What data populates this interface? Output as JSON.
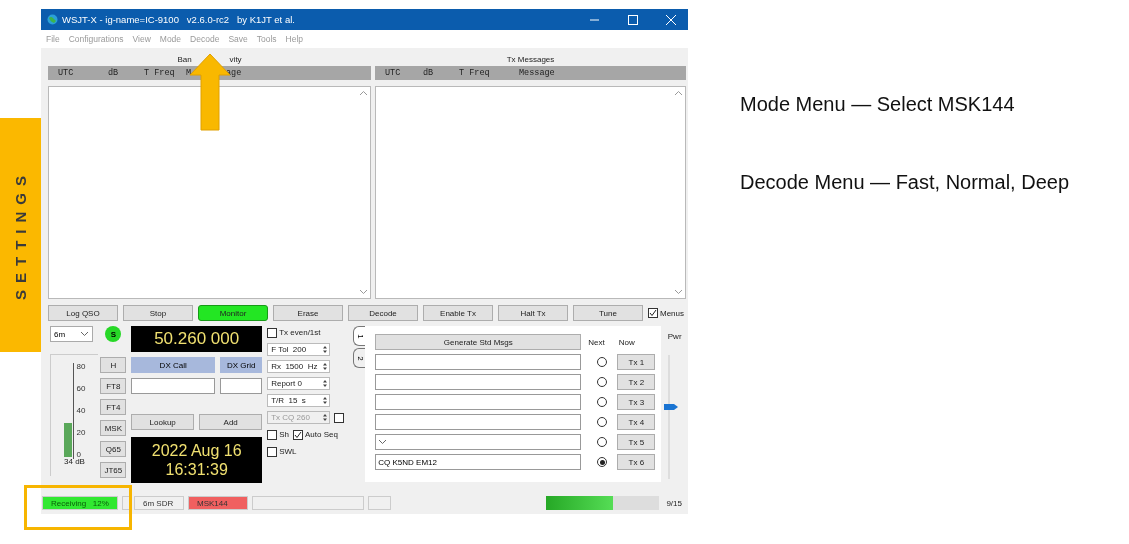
{
  "side_tab": {
    "label": "SETTINGS"
  },
  "window": {
    "title": "WSJT-X - ig-name=IC-9100   v2.6.0-rc2   by K1JT et al."
  },
  "menu": [
    "File",
    "Configurations",
    "View",
    "Mode",
    "Decode",
    "Save",
    "Tools",
    "Help"
  ],
  "band_activity": {
    "title_parts": [
      "Ban",
      "vity"
    ],
    "columns": [
      "UTC",
      "dB",
      "T Freq",
      "M",
      "age"
    ]
  },
  "tx_messages": {
    "title": "Tx Messages",
    "columns": [
      "UTC",
      "dB",
      "T Freq",
      "Message"
    ]
  },
  "buttons": [
    {
      "label": "Log QSO",
      "on": false
    },
    {
      "label": "Stop",
      "on": false
    },
    {
      "label": "Monitor",
      "on": true
    },
    {
      "label": "Erase",
      "on": false
    },
    {
      "label": "Decode",
      "on": false
    },
    {
      "label": "Enable Tx",
      "on": false
    },
    {
      "label": "Halt Tx",
      "on": false
    },
    {
      "label": "Tune",
      "on": false
    }
  ],
  "menus_checkbox": {
    "label": "Menus",
    "checked": true
  },
  "band": {
    "value": "6m"
  },
  "s_indicator": "S",
  "signal_meter": {
    "ticks": [
      "80",
      "60",
      "40",
      "20",
      "0"
    ],
    "level": 0.38,
    "reading": "34 dB"
  },
  "mode_buttons": [
    "H",
    "FT8",
    "FT4",
    "MSK",
    "Q65",
    "JT65"
  ],
  "frequency": "50.260 000",
  "dx_labels": [
    "DX Call",
    "DX Grid"
  ],
  "lookup_buttons": [
    "Lookup",
    "Add"
  ],
  "clock": {
    "date": "2022 Aug 16",
    "time": "16:31:39"
  },
  "options": [
    {
      "items": [
        {
          "kind": "checkbox",
          "label": "Tx even/1st",
          "checked": false
        }
      ]
    },
    {
      "items": [
        {
          "kind": "spin",
          "value": "F Tol  200",
          "disabled": false
        }
      ]
    },
    {
      "items": [
        {
          "kind": "spin",
          "value": "Rx  1500  Hz",
          "disabled": false
        }
      ]
    },
    {
      "items": [
        {
          "kind": "spin",
          "value": "Report 0",
          "disabled": false
        }
      ]
    },
    {
      "items": [
        {
          "kind": "spin",
          "value": "T/R  15  s",
          "disabled": false
        }
      ]
    },
    {
      "items": [
        {
          "kind": "spin",
          "value": "Tx CQ 260",
          "disabled": true
        },
        {
          "kind": "checkbox",
          "checked": false
        }
      ]
    },
    {
      "items": [
        {
          "kind": "checkbox",
          "label": "Sh",
          "checked": false
        },
        {
          "kind": "checkbox",
          "label": "Auto Seq",
          "checked": true
        }
      ]
    },
    {
      "items": [
        {
          "kind": "checkbox",
          "label": "SWL",
          "checked": false
        }
      ]
    }
  ],
  "tabs": [
    {
      "label": "1",
      "selected": true
    },
    {
      "label": "2",
      "selected": false
    }
  ],
  "generate_button": "Generate Std Msgs",
  "next_label": "Next",
  "now_label": "Now",
  "messages": [
    {
      "kind": "text",
      "selected": false,
      "button": "Tx 1"
    },
    {
      "kind": "text",
      "selected": false,
      "button": "Tx 2"
    },
    {
      "kind": "text",
      "selected": false,
      "button": "Tx 3"
    },
    {
      "kind": "text",
      "selected": false,
      "button": "Tx 4"
    },
    {
      "kind": "dropdown",
      "selected": false,
      "button": "Tx 5"
    },
    {
      "kind": "text",
      "value": "CQ K5ND EM12",
      "selected": true,
      "button": "Tx 6"
    }
  ],
  "power": {
    "label": "Pwr",
    "level": 0.58
  },
  "status_bar": {
    "receiving": "Receiving   12%",
    "band_sdr": "6m SDR",
    "mode": "MSK144",
    "progress": {
      "level": 0.59
    },
    "period": "9/15"
  },
  "notes": [
    "Mode Menu — Select MSK144",
    "Decode Menu — Fast, Normal, Deep"
  ]
}
